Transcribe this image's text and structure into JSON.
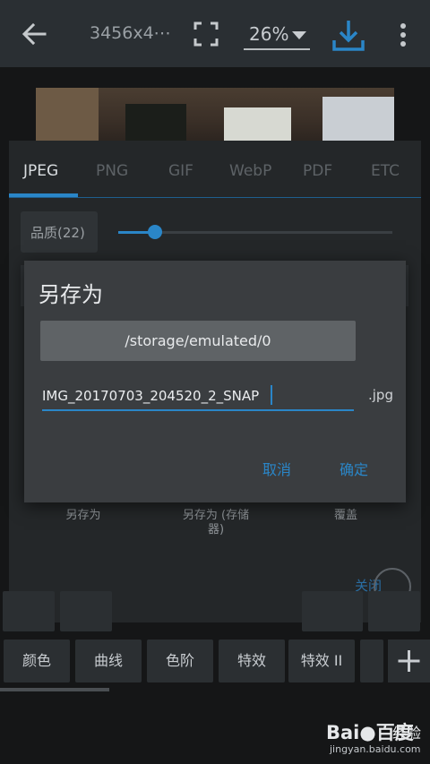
{
  "top_bar": {
    "image_size": "3456x4⋯",
    "zoom": "26%"
  },
  "tabs": [
    "JPEG",
    "PNG",
    "GIF",
    "WebP",
    "PDF",
    "ETC"
  ],
  "active_tab": "JPEG",
  "quality_label": "品质(22)",
  "quality_value": 22,
  "dialog": {
    "title": "另存为",
    "path": "/storage/emulated/0",
    "filename": "IMG_20170703_204520_2_SNAP",
    "extension": ".jpg",
    "cancel": "取消",
    "confirm": "确定"
  },
  "options": {
    "save_as": "另存为",
    "save_as_storage": "另存为 (存储器)",
    "overwrite": "覆盖",
    "close": "关闭"
  },
  "toolbar": [
    "颜色",
    "曲线",
    "色阶",
    "特效",
    "特效 II"
  ],
  "watermark": {
    "brand": "Bai●百度",
    "brand2": "经验",
    "url": "jingyan.baidu.com"
  },
  "colors": {
    "accent": "#2a86c8",
    "bar": "#2a2f33",
    "panel": "#242729",
    "dialog": "#3a3d40"
  }
}
